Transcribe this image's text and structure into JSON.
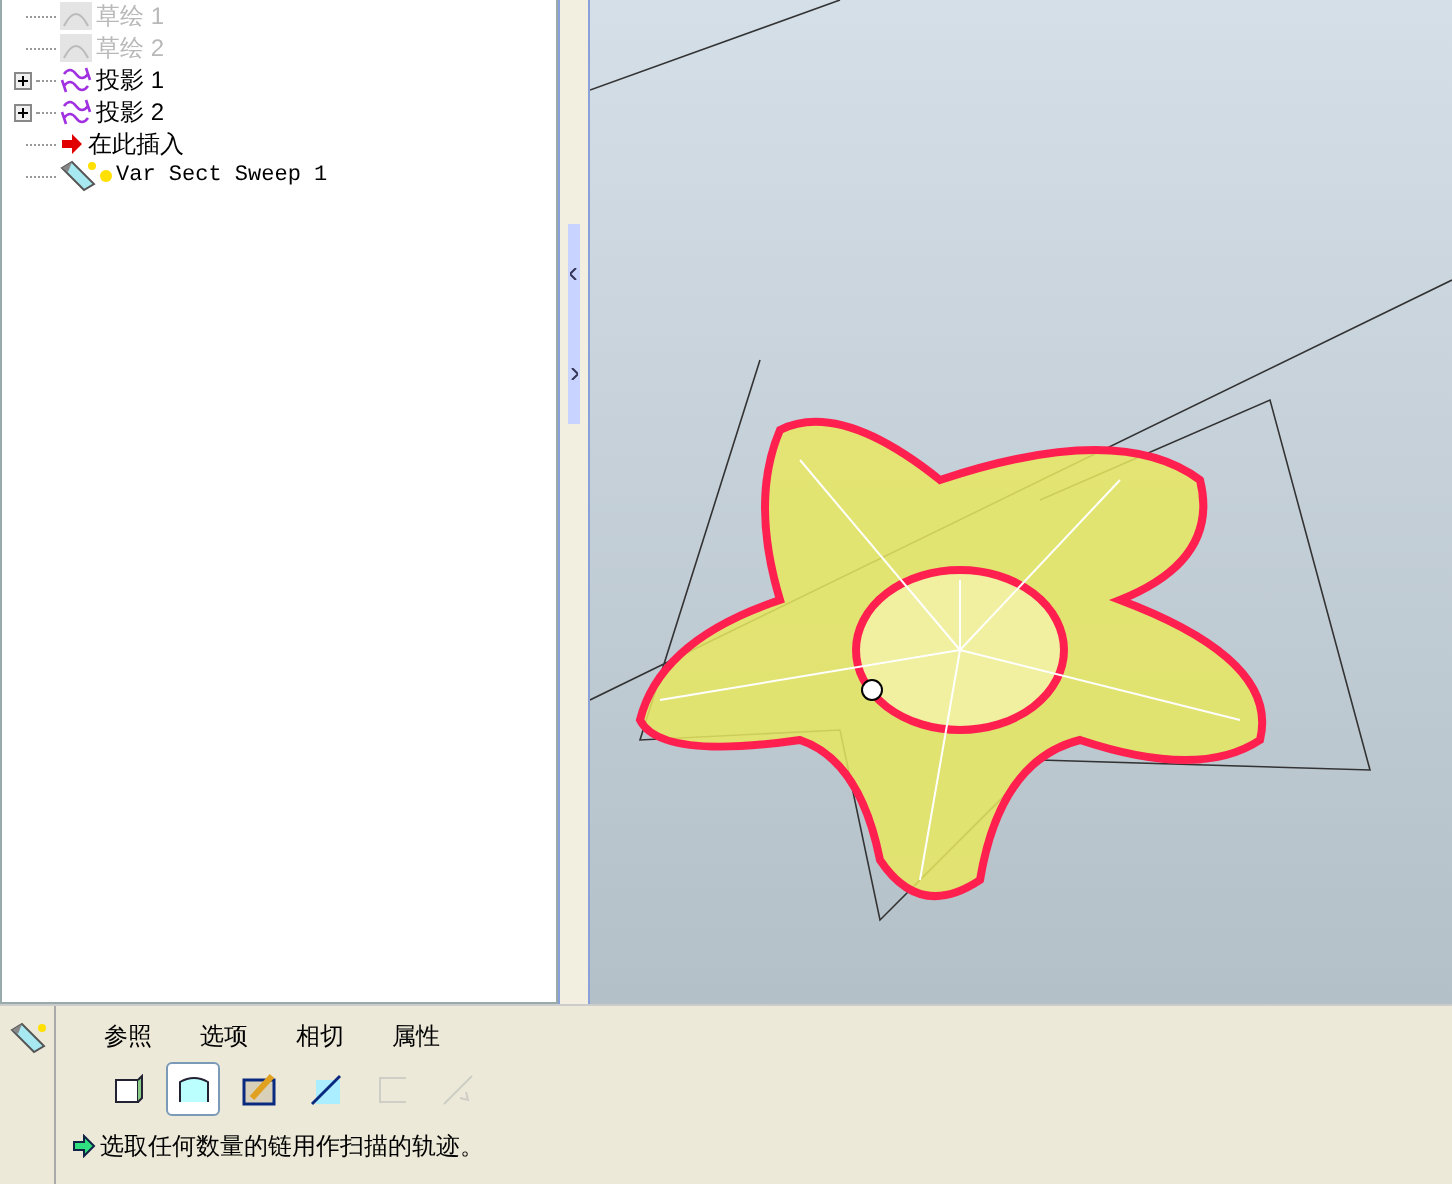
{
  "tree": [
    {
      "label": "草绘 1",
      "kind": "sketch",
      "disabled": true,
      "expandable": false
    },
    {
      "label": "草绘 2",
      "kind": "sketch",
      "disabled": true,
      "expandable": false
    },
    {
      "label": "投影 1",
      "kind": "projection",
      "disabled": false,
      "expandable": true
    },
    {
      "label": "投影 2",
      "kind": "projection",
      "disabled": false,
      "expandable": true
    },
    {
      "label": "在此插入",
      "kind": "insert",
      "disabled": false,
      "expandable": false
    },
    {
      "label": "Var Sect Sweep 1",
      "kind": "sweep",
      "disabled": false,
      "expandable": false
    }
  ],
  "dashboard": {
    "tabs": [
      {
        "label": "参照",
        "selected": false
      },
      {
        "label": "选项",
        "selected": false
      },
      {
        "label": "相切",
        "selected": false
      },
      {
        "label": "属性",
        "selected": false
      }
    ],
    "tools": [
      {
        "kind": "solid",
        "selected": false,
        "disabled": false
      },
      {
        "kind": "surface",
        "selected": true,
        "disabled": false
      },
      {
        "kind": "sketch",
        "selected": false,
        "disabled": false
      },
      {
        "kind": "remove",
        "selected": false,
        "disabled": false
      },
      {
        "kind": "thicken",
        "selected": false,
        "disabled": true
      },
      {
        "kind": "arrow",
        "selected": false,
        "disabled": true
      }
    ],
    "message": "选取任何数量的链用作扫描的轨迹。"
  }
}
